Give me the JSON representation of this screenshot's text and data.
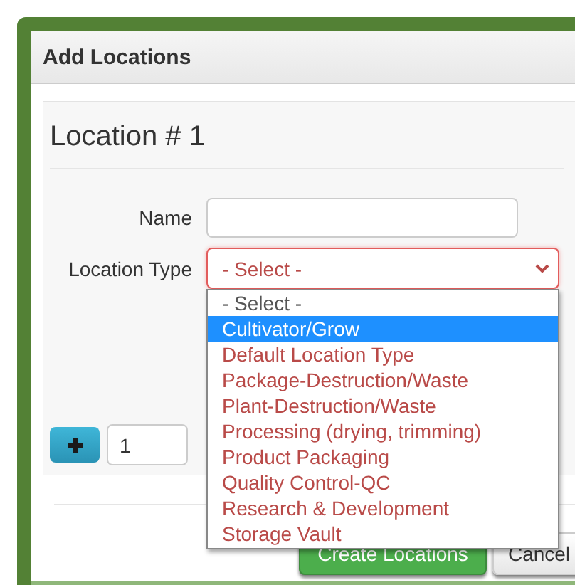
{
  "dialog": {
    "title": "Add Locations"
  },
  "location": {
    "heading": "Location # 1",
    "name_field": {
      "label": "Name"
    },
    "type_field": {
      "label": "Location Type",
      "value": "- Select -",
      "invalid": true,
      "expanded": true,
      "options": [
        {
          "label": "- Select -",
          "selected": true,
          "highlighted": false
        },
        {
          "label": "Cultivator/Grow",
          "selected": false,
          "highlighted": true
        },
        {
          "label": "Default Location Type",
          "selected": false,
          "highlighted": false
        },
        {
          "label": "Package-Destruction/Waste",
          "selected": false,
          "highlighted": false
        },
        {
          "label": "Plant-Destruction/Waste",
          "selected": false,
          "highlighted": false
        },
        {
          "label": "Processing (drying, trimming)",
          "selected": false,
          "highlighted": false
        },
        {
          "label": "Product Packaging",
          "selected": false,
          "highlighted": false
        },
        {
          "label": "Quality Control-QC",
          "selected": false,
          "highlighted": false
        },
        {
          "label": "Research & Development",
          "selected": false,
          "highlighted": false
        },
        {
          "label": "Storage Vault",
          "selected": false,
          "highlighted": false
        }
      ]
    }
  },
  "add_row": {
    "count": "1"
  },
  "buttons": [
    {
      "label": "Create Locations",
      "kind": "primary"
    },
    {
      "label": "Cancel",
      "kind": "default"
    }
  ]
}
